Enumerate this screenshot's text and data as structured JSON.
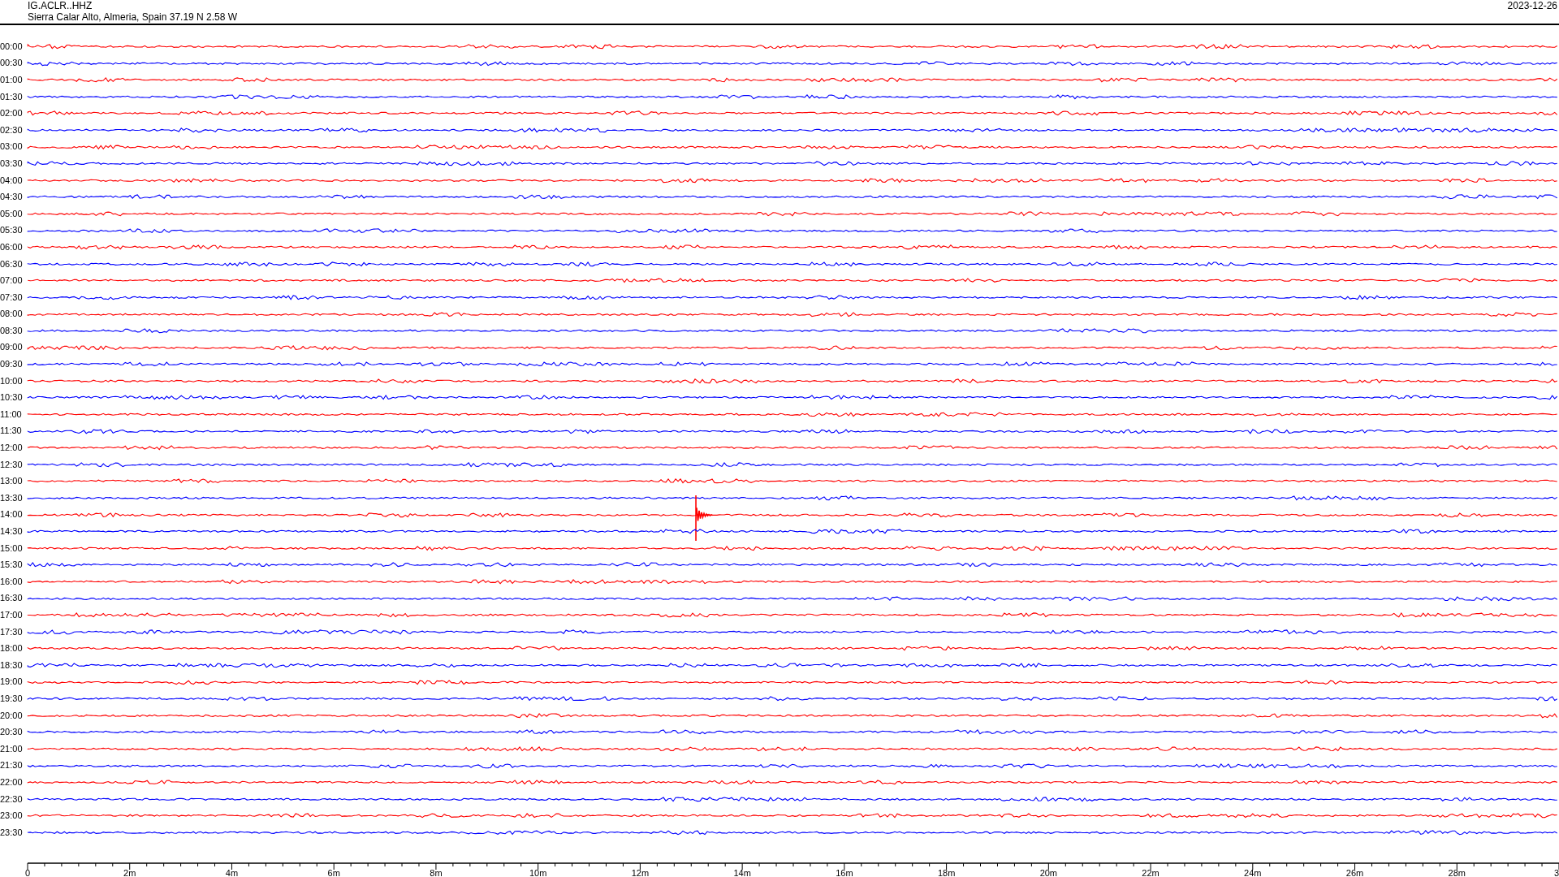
{
  "header": {
    "station": "IG.ACLR..HHZ",
    "location": "Sierra Calar Alto, Almeria, Spain  37.19 N 2.58 W",
    "date": "2023-12-26"
  },
  "rows": [
    {
      "time": "00:00",
      "color": "#ff0000",
      "event": false
    },
    {
      "time": "00:30",
      "color": "#0000ff",
      "event": false
    },
    {
      "time": "01:00",
      "color": "#ff0000",
      "event": false
    },
    {
      "time": "01:30",
      "color": "#0000ff",
      "event": false
    },
    {
      "time": "02:00",
      "color": "#ff0000",
      "event": false
    },
    {
      "time": "02:30",
      "color": "#0000ff",
      "event": false
    },
    {
      "time": "03:00",
      "color": "#ff0000",
      "event": false
    },
    {
      "time": "03:30",
      "color": "#0000ff",
      "event": false
    },
    {
      "time": "04:00",
      "color": "#ff0000",
      "event": false
    },
    {
      "time": "04:30",
      "color": "#0000ff",
      "event": false
    },
    {
      "time": "05:00",
      "color": "#ff0000",
      "event": false
    },
    {
      "time": "05:30",
      "color": "#0000ff",
      "event": false
    },
    {
      "time": "06:00",
      "color": "#ff0000",
      "event": false
    },
    {
      "time": "06:30",
      "color": "#0000ff",
      "event": false
    },
    {
      "time": "07:00",
      "color": "#ff0000",
      "event": false
    },
    {
      "time": "07:30",
      "color": "#0000ff",
      "event": false
    },
    {
      "time": "08:00",
      "color": "#ff0000",
      "event": false
    },
    {
      "time": "08:30",
      "color": "#0000ff",
      "event": false
    },
    {
      "time": "09:00",
      "color": "#ff0000",
      "event": false
    },
    {
      "time": "09:30",
      "color": "#0000ff",
      "event": false
    },
    {
      "time": "10:00",
      "color": "#ff0000",
      "event": false
    },
    {
      "time": "10:30",
      "color": "#0000ff",
      "event": false
    },
    {
      "time": "11:00",
      "color": "#ff0000",
      "event": false
    },
    {
      "time": "11:30",
      "color": "#0000ff",
      "event": false
    },
    {
      "time": "12:00",
      "color": "#ff0000",
      "event": false
    },
    {
      "time": "12:30",
      "color": "#0000ff",
      "event": false
    },
    {
      "time": "13:00",
      "color": "#ff0000",
      "event": false
    },
    {
      "time": "13:30",
      "color": "#0000ff",
      "event": false
    },
    {
      "time": "14:00",
      "color": "#ff0000",
      "event": true
    },
    {
      "time": "14:30",
      "color": "#0000ff",
      "event": false
    },
    {
      "time": "15:00",
      "color": "#ff0000",
      "event": false
    },
    {
      "time": "15:30",
      "color": "#0000ff",
      "event": false
    },
    {
      "time": "16:00",
      "color": "#ff0000",
      "event": false
    },
    {
      "time": "16:30",
      "color": "#0000ff",
      "event": false
    },
    {
      "time": "17:00",
      "color": "#ff0000",
      "event": false
    },
    {
      "time": "17:30",
      "color": "#0000ff",
      "event": false
    },
    {
      "time": "18:00",
      "color": "#ff0000",
      "event": false
    },
    {
      "time": "18:30",
      "color": "#0000ff",
      "event": false
    },
    {
      "time": "19:00",
      "color": "#ff0000",
      "event": false
    },
    {
      "time": "19:30",
      "color": "#0000ff",
      "event": false
    },
    {
      "time": "20:00",
      "color": "#ff0000",
      "event": false
    },
    {
      "time": "20:30",
      "color": "#0000ff",
      "event": false
    },
    {
      "time": "21:00",
      "color": "#ff0000",
      "event": false
    },
    {
      "time": "21:30",
      "color": "#0000ff",
      "event": false
    },
    {
      "time": "22:00",
      "color": "#ff0000",
      "event": false
    },
    {
      "time": "22:30",
      "color": "#0000ff",
      "event": false
    },
    {
      "time": "23:00",
      "color": "#ff0000",
      "event": false
    },
    {
      "time": "23:30",
      "color": "#0000ff",
      "event": false
    }
  ],
  "x_axis": {
    "labels": [
      "0",
      "2m",
      "4m",
      "6m",
      "8m",
      "10m",
      "12m",
      "14m",
      "16m",
      "18m",
      "20m",
      "22m",
      "24m",
      "26m",
      "28m",
      "3"
    ]
  }
}
